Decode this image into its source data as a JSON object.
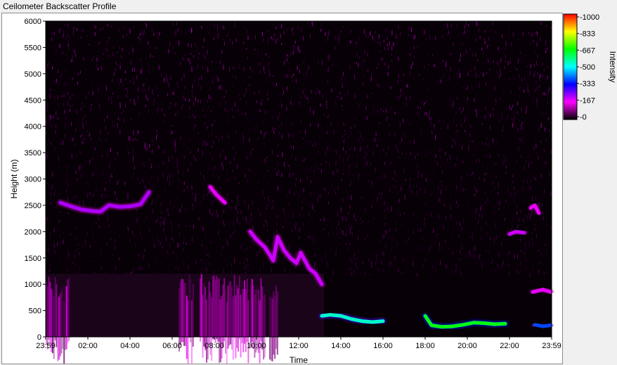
{
  "window": {
    "title": "Ceilometer Backscatter Profile"
  },
  "chart_data": {
    "type": "heatmap",
    "title": "Ceilometer Backscatter Profile",
    "xlabel": "Time",
    "ylabel": "Height (m)",
    "x_ticks": [
      "23:59",
      "02:00",
      "04:00",
      "06:00",
      "08:00",
      "10:00",
      "12:00",
      "14:00",
      "16:00",
      "18:00",
      "20:00",
      "22:00",
      "23:59"
    ],
    "y_ticks": [
      0,
      500,
      1000,
      1500,
      2000,
      2500,
      3000,
      3500,
      4000,
      4500,
      5000,
      5500,
      6000
    ],
    "ylim": [
      0,
      6000
    ],
    "xlim_hours": [
      0,
      24
    ],
    "grid": false,
    "colorbar": {
      "label": "Intensity",
      "range": [
        0,
        1000
      ],
      "ticks": [
        "1000",
        "833",
        "667",
        "500",
        "333",
        "167",
        "0"
      ],
      "colors": [
        "#000000",
        "#ff00ff",
        "#0000ff",
        "#00ffff",
        "#00ff00",
        "#ffff00",
        "#ff0000"
      ]
    },
    "layers": [
      {
        "name": "cloud-layer-morning",
        "t": [
          0.7,
          1.2,
          1.7,
          2.2,
          2.6,
          3.0,
          3.5,
          4.0,
          4.5,
          4.9
        ],
        "h": [
          2550,
          2480,
          2420,
          2390,
          2380,
          2500,
          2470,
          2480,
          2520,
          2750
        ],
        "intensity": 220
      },
      {
        "name": "cloud-layer-late-morning",
        "t": [
          7.8,
          8.1,
          8.5
        ],
        "h": [
          2850,
          2700,
          2550
        ],
        "intensity": 180
      },
      {
        "name": "descending-layer",
        "t": [
          9.7,
          10.0,
          10.4,
          10.8,
          11.0,
          11.3,
          11.6,
          11.9,
          12.1,
          12.5,
          12.8,
          13.1
        ],
        "h": [
          2000,
          1850,
          1700,
          1450,
          1900,
          1650,
          1500,
          1400,
          1600,
          1300,
          1200,
          1000
        ],
        "intensity": 200
      },
      {
        "name": "boundary-layer-afternoon",
        "t": [
          13.1,
          13.5,
          14.0,
          14.5,
          15.0,
          15.5,
          16.0
        ],
        "h": [
          400,
          420,
          400,
          340,
          300,
          280,
          300
        ],
        "intensity": 520
      },
      {
        "name": "boundary-layer-evening",
        "t": [
          18.0,
          18.3,
          18.8,
          19.3,
          19.8,
          20.3,
          20.8,
          21.3,
          21.8
        ],
        "h": [
          400,
          220,
          190,
          200,
          230,
          270,
          260,
          240,
          250
        ],
        "intensity": 640
      },
      {
        "name": "evening-high-layer",
        "t": [
          22.0,
          22.3,
          22.7
        ],
        "h": [
          1950,
          2000,
          1980
        ],
        "intensity": 200
      },
      {
        "name": "late-layer",
        "t": [
          23.0,
          23.2,
          23.4
        ],
        "h": [
          2450,
          2500,
          2350
        ],
        "intensity": 180
      },
      {
        "name": "late-low-layer",
        "t": [
          23.1,
          23.6,
          23.95
        ],
        "h": [
          850,
          900,
          850
        ],
        "intensity": 180
      },
      {
        "name": "late-surface-layer",
        "t": [
          23.2,
          23.6,
          23.95
        ],
        "h": [
          230,
          200,
          220
        ],
        "intensity": 380
      }
    ],
    "low_level_band": {
      "h_top": 1200,
      "t_range": [
        0,
        13.2
      ],
      "intensity": 120
    }
  }
}
